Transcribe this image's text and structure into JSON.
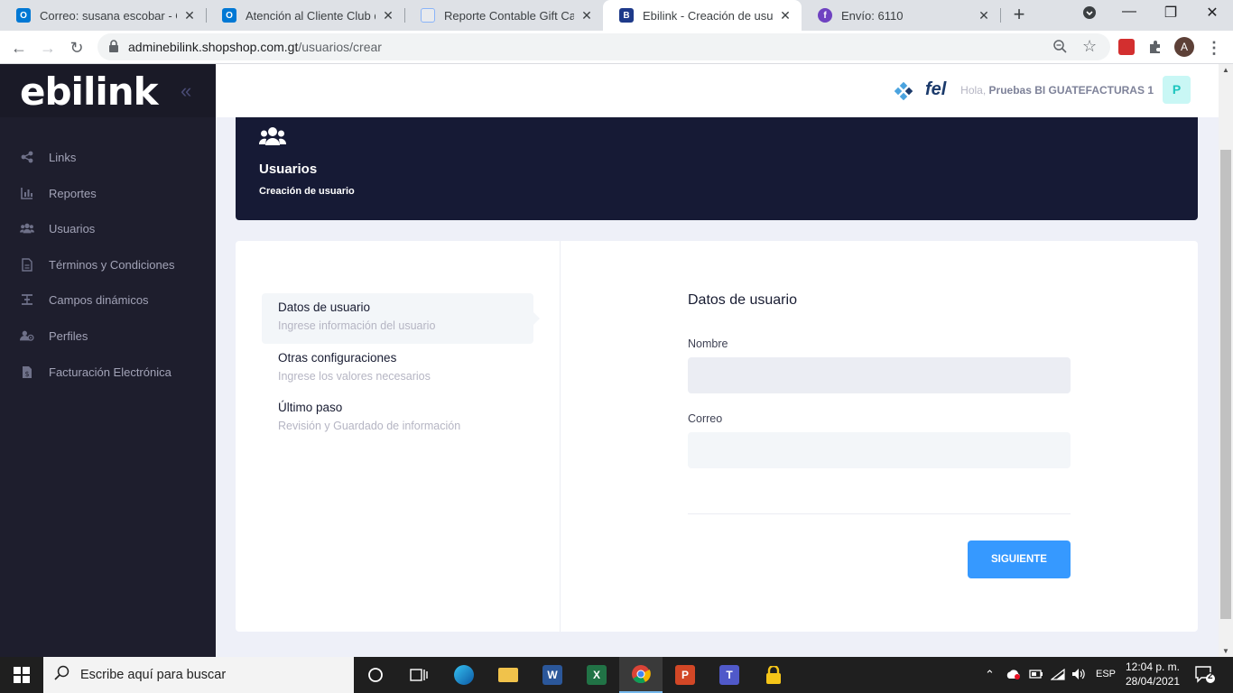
{
  "browser": {
    "tabs": [
      {
        "title": "Correo: susana escobar - Out",
        "icon_color": "#0078d4",
        "icon_letter": "O"
      },
      {
        "title": "Atención al Cliente Club de C",
        "icon_color": "#0078d4",
        "icon_letter": "O"
      },
      {
        "title": "Reporte Contable Gift Cards -",
        "icon_color": "#8ab4f8",
        "icon_letter": ""
      },
      {
        "title": "Ebilink - Creación de usuario",
        "icon_color": "#1e3a8a",
        "icon_letter": "B"
      },
      {
        "title": "Envío: 6110",
        "icon_color": "#6f42c1",
        "icon_letter": "f"
      }
    ],
    "url_host": "adminebilink.shopshop.com.gt",
    "url_path": "/usuarios/crear",
    "profile_letter": "A"
  },
  "sidebar": {
    "logo": "ebilink",
    "collapse_icon": "«",
    "items": [
      {
        "label": "Links",
        "icon": "share-icon"
      },
      {
        "label": "Reportes",
        "icon": "chart-icon"
      },
      {
        "label": "Usuarios",
        "icon": "users-icon"
      },
      {
        "label": "Términos y Condiciones",
        "icon": "file-icon"
      },
      {
        "label": "Campos dinámicos",
        "icon": "align-icon"
      },
      {
        "label": "Perfiles",
        "icon": "profiles-icon"
      },
      {
        "label": "Facturación Electrónica",
        "icon": "invoice-icon"
      }
    ]
  },
  "header": {
    "hello": "Hola,",
    "username": "Pruebas BI GUATEFACTURAS 1",
    "avatar_letter": "P",
    "fel_logo": "fel"
  },
  "banner": {
    "title": "Usuarios",
    "subtitle": "Creación de usuario"
  },
  "wizard": {
    "steps": [
      {
        "title": "Datos de usuario",
        "desc": "Ingrese información del usuario"
      },
      {
        "title": "Otras configuraciones",
        "desc": "Ingrese los valores necesarios"
      },
      {
        "title": "Último paso",
        "desc": "Revisión y Guardado de información"
      }
    ]
  },
  "form": {
    "title": "Datos de usuario",
    "name_label": "Nombre",
    "name_value": "",
    "email_label": "Correo",
    "email_value": "",
    "next_label": "SIGUIENTE"
  },
  "taskbar": {
    "search_placeholder": "Escribe aquí para buscar",
    "lang": "ESP",
    "time": "12:04 p. m.",
    "date": "28/04/2021",
    "notifications": "2"
  },
  "colors": {
    "sidebar_bg": "#1e1e2d",
    "banner_bg": "#161a35",
    "primary": "#3699ff"
  }
}
